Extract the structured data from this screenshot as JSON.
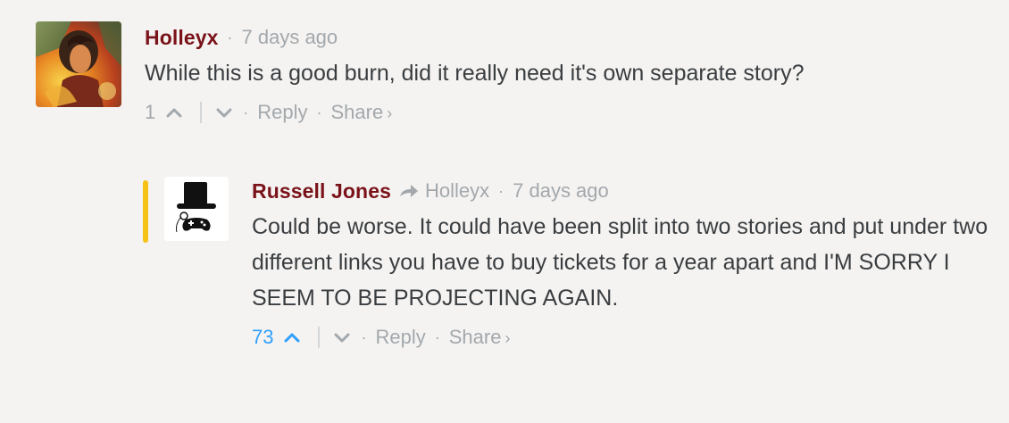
{
  "comments": [
    {
      "author": "Holleyx",
      "separator": "·",
      "time": "7 days ago",
      "text": "While this is a good burn, did it really need it's own separate story?",
      "upvotes": "1",
      "reply_label": "Reply",
      "share_label": "Share",
      "share_chevron": "›",
      "avatar_icon": "painted-portrait-avatar"
    },
    {
      "author": "Russell Jones",
      "reply_to": "Holleyx",
      "separator": "·",
      "time": "7 days ago",
      "text": "Could be worse. It could have been split into two stories and put under two different links you have to buy tickets for a year apart and I'M SORRY I SEEM TO BE PROJECTING AGAIN.",
      "upvotes": "73",
      "upvoted": true,
      "reply_label": "Reply",
      "share_label": "Share",
      "share_chevron": "›",
      "avatar_icon": "top-hat-gamepad-avatar",
      "highlight_color": "#f5c215"
    }
  ],
  "colors": {
    "author": "#7a1219",
    "meta": "#a3a8ad",
    "text": "#3a3d40",
    "upvote_active": "#2e9fff",
    "background": "#f4f3f1"
  }
}
